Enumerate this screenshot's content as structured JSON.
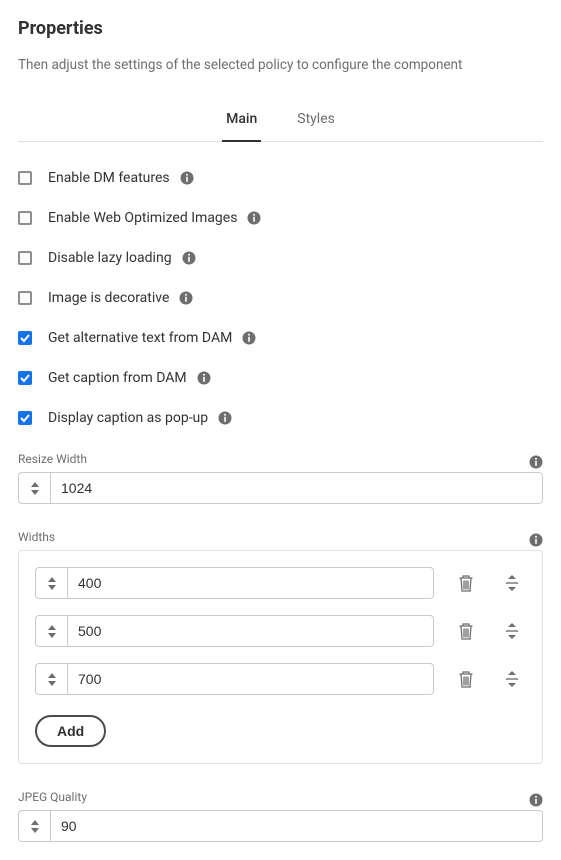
{
  "header": {
    "title": "Properties",
    "subtitle": "Then adjust the settings of the selected policy to configure the component"
  },
  "tabs": {
    "main": "Main",
    "styles": "Styles"
  },
  "checkboxes": {
    "enable_dm": "Enable DM features",
    "enable_web_opt": "Enable Web Optimized Images",
    "disable_lazy": "Disable lazy loading",
    "decorative": "Image is decorative",
    "alt_from_dam": "Get alternative text from DAM",
    "caption_from_dam": "Get caption from DAM",
    "caption_popup": "Display caption as pop-up"
  },
  "resize": {
    "label": "Resize Width",
    "value": "1024"
  },
  "widths": {
    "label": "Widths",
    "items": [
      "400",
      "500",
      "700"
    ],
    "add_label": "Add"
  },
  "jpeg": {
    "label": "JPEG Quality",
    "value": "90"
  }
}
